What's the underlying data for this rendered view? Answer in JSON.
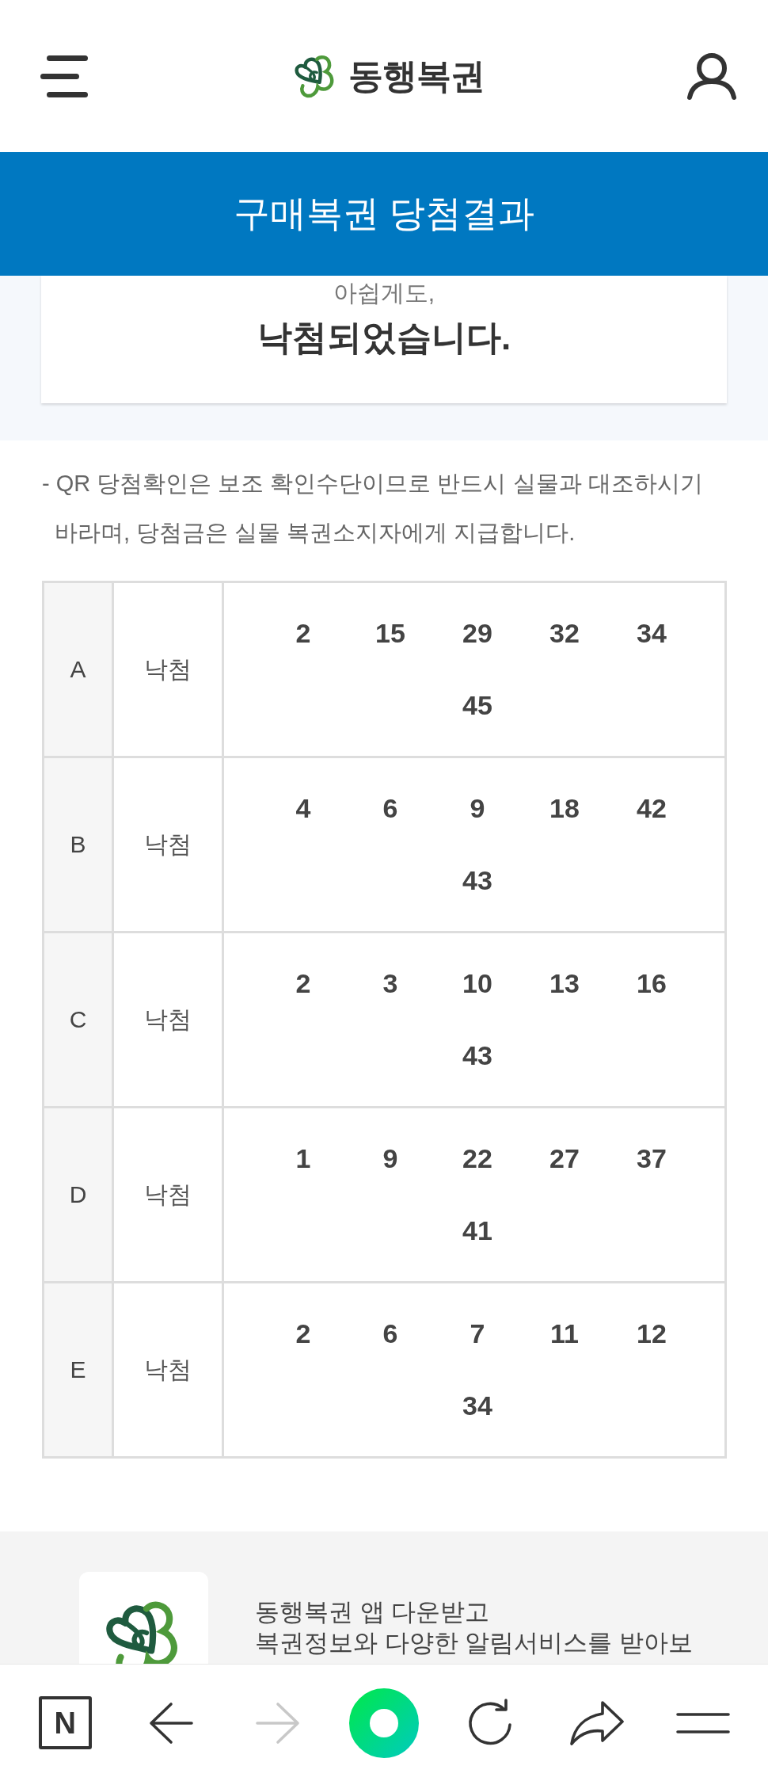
{
  "header": {
    "logo_text": "동행복권"
  },
  "banner": {
    "title": "구매복권 당첨결과"
  },
  "result_card": {
    "partial_text": "아쉽게도,",
    "message": "낙첨되었습니다."
  },
  "notice": "- QR 당첨확인은 보조 확인수단이므로 반드시 실물과 대조하시기 바라며, 당첨금은 실물 복권소지자에게 지급합니다.",
  "games": [
    {
      "label": "A",
      "result": "낙첨",
      "numbers": [
        "2",
        "15",
        "29",
        "32",
        "34",
        "45"
      ]
    },
    {
      "label": "B",
      "result": "낙첨",
      "numbers": [
        "4",
        "6",
        "9",
        "18",
        "42",
        "43"
      ]
    },
    {
      "label": "C",
      "result": "낙첨",
      "numbers": [
        "2",
        "3",
        "10",
        "13",
        "16",
        "43"
      ]
    },
    {
      "label": "D",
      "result": "낙첨",
      "numbers": [
        "1",
        "9",
        "22",
        "27",
        "37",
        "41"
      ]
    },
    {
      "label": "E",
      "result": "낙첨",
      "numbers": [
        "2",
        "6",
        "7",
        "11",
        "12",
        "34"
      ]
    }
  ],
  "app_promo": {
    "lines": [
      "동행복권 앱 다운받고",
      "복권정보와 다양한 알림서비스를 받아보"
    ]
  },
  "browser_toolbar": [
    {
      "kind": "letter-box",
      "label": "N",
      "disabled": false
    },
    {
      "kind": "back",
      "disabled": false
    },
    {
      "kind": "forward",
      "disabled": true
    },
    {
      "kind": "ring",
      "disabled": false
    },
    {
      "kind": "reload",
      "disabled": false
    },
    {
      "kind": "share",
      "disabled": false
    },
    {
      "kind": "menu",
      "disabled": false
    }
  ]
}
